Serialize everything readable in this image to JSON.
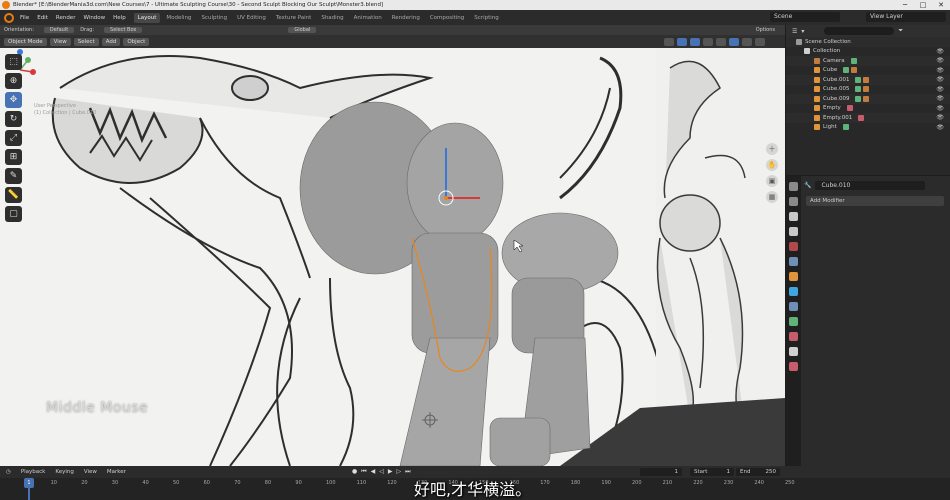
{
  "window": {
    "title": "Blender* [E:\\BlenderMania3d.com\\New Courses\\7 - Ultimate Sculpting Course\\30 - Second Sculpt Blocking Our Sculpt\\Monster3.blend]",
    "minimize": "─",
    "maximize": "□",
    "close": "✕"
  },
  "menu": {
    "items": [
      "File",
      "Edit",
      "Render",
      "Window",
      "Help"
    ],
    "tabs": [
      "Layout",
      "Modeling",
      "Sculpting",
      "UV Editing",
      "Texture Paint",
      "Shading",
      "Animation",
      "Rendering",
      "Compositing",
      "Scripting"
    ],
    "active_tab": "Layout",
    "scene": "Scene",
    "view_layer": "View Layer"
  },
  "tool_header": {
    "orientation_label": "Orientation:",
    "orientation_value": "Default",
    "drag_label": "Drag:",
    "drag_value": "Select Box",
    "transform_orientation": "Global",
    "options": "Options"
  },
  "viewport_header": {
    "mode": "Object Mode",
    "buttons": [
      "View",
      "Select",
      "Add",
      "Object"
    ]
  },
  "viewport": {
    "view_name": "User Perspective",
    "collection_info": "(1) Collection | Cube.010",
    "overlay_text": "Middle Mouse"
  },
  "outliner": {
    "title": "Scene Collection",
    "rows": [
      {
        "label": "Scene Collection",
        "indent": 0,
        "color": "#9a9a9a"
      },
      {
        "label": "Collection",
        "indent": 1,
        "color": "#cfcfcf"
      },
      {
        "label": "Camera",
        "indent": 2,
        "color": "#c47b3f"
      },
      {
        "label": "Cube",
        "indent": 2,
        "color": "#e2943b"
      },
      {
        "label": "Cube.001",
        "indent": 2,
        "color": "#e2943b"
      },
      {
        "label": "Cube.005",
        "indent": 2,
        "color": "#e2943b"
      },
      {
        "label": "Cube.009",
        "indent": 2,
        "color": "#e2943b"
      },
      {
        "label": "Empty",
        "indent": 2,
        "color": "#e2943b"
      },
      {
        "label": "Empty.001",
        "indent": 2,
        "color": "#e2943b"
      },
      {
        "label": "Light",
        "indent": 2,
        "color": "#e2943b"
      }
    ],
    "eye": "👁"
  },
  "properties": {
    "object": "Cube.010",
    "add_modifier": "Add Modifier",
    "tab_colors": [
      "#8a8a8a",
      "#8a8a8a",
      "#c8c8c8",
      "#c8c8c8",
      "#b04a4a",
      "#6f8fb8",
      "#e2943b",
      "#6f8fb8",
      "#3fa6e0",
      "#5fb37a",
      "#c75d6a",
      "#d0d0d0",
      "#c75d6a"
    ]
  },
  "timeline": {
    "menu": [
      "Playback",
      "Keying",
      "View",
      "Marker"
    ],
    "frame_current": "1",
    "start_label": "Start",
    "start": "1",
    "end_label": "End",
    "end": "250",
    "ruler": [
      "1",
      "10",
      "20",
      "30",
      "40",
      "50",
      "60",
      "70",
      "80",
      "90",
      "100",
      "110",
      "120",
      "130",
      "140",
      "150",
      "160",
      "170",
      "180",
      "190",
      "200",
      "210",
      "220",
      "230",
      "240",
      "250"
    ],
    "playhead": "1"
  },
  "subtitle": "好吧,才华横溢。"
}
